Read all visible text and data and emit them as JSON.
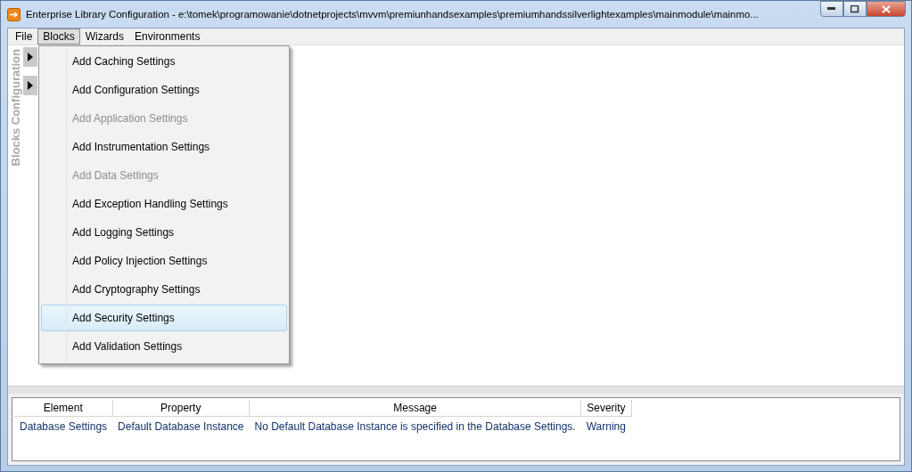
{
  "window": {
    "title": "Enterprise Library Configuration - e:\\tomek\\programowanie\\dotnetprojects\\mvvm\\premiunhandsexamples\\premiumhandssilverlightexamples\\mainmodule\\mainmo..."
  },
  "menu_bar": [
    {
      "label": "File",
      "selected": false
    },
    {
      "label": "Blocks",
      "selected": true
    },
    {
      "label": "Wizards",
      "selected": false
    },
    {
      "label": "Environments",
      "selected": false
    }
  ],
  "side_panel": {
    "title": "Blocks Configuration"
  },
  "blocks_menu": [
    {
      "label": "Add Caching Settings",
      "disabled": false,
      "selected": false
    },
    {
      "label": "Add Configuration Settings",
      "disabled": false,
      "selected": false
    },
    {
      "label": "Add Application Settings",
      "disabled": true,
      "selected": false
    },
    {
      "label": "Add Instrumentation Settings",
      "disabled": false,
      "selected": false
    },
    {
      "label": "Add Data Settings",
      "disabled": true,
      "selected": false
    },
    {
      "label": "Add Exception Handling Settings",
      "disabled": false,
      "selected": false
    },
    {
      "label": "Add Logging Settings",
      "disabled": false,
      "selected": false
    },
    {
      "label": "Add Policy Injection Settings",
      "disabled": false,
      "selected": false
    },
    {
      "label": "Add Cryptography Settings",
      "disabled": false,
      "selected": false
    },
    {
      "label": "Add Security Settings",
      "disabled": false,
      "selected": true
    },
    {
      "label": "Add Validation Settings",
      "disabled": false,
      "selected": false
    }
  ],
  "validation_table": {
    "columns": [
      "Element",
      "Property",
      "Message",
      "Severity"
    ],
    "rows": [
      [
        "Database Settings",
        "Default Database Instance",
        "No Default Database Instance is specified in the Database Settings.",
        "Warning"
      ]
    ]
  }
}
